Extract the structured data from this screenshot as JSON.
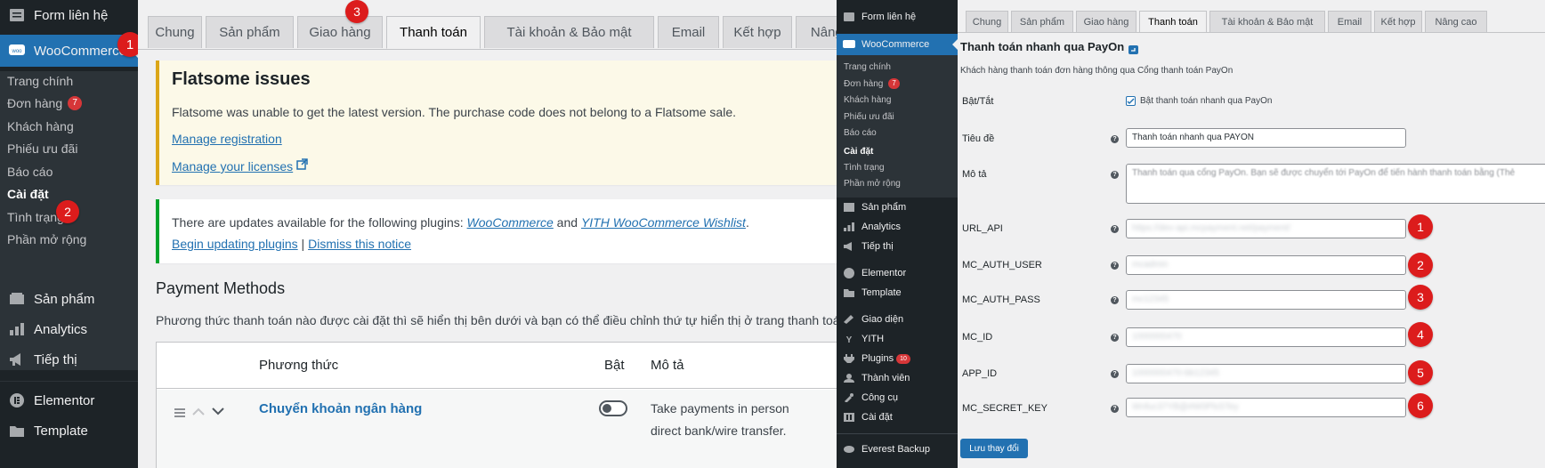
{
  "left": {
    "sidebar": {
      "items_top": [
        {
          "icon": "form-icon",
          "label": "Form liên hệ"
        },
        {
          "icon": "woo-icon",
          "label": "WooCommerce"
        }
      ],
      "woo_sub": [
        {
          "label": "Trang chính"
        },
        {
          "label": "Đơn hàng",
          "count": "7"
        },
        {
          "label": "Khách hàng"
        },
        {
          "label": "Phiếu ưu đãi"
        },
        {
          "label": "Báo cáo"
        },
        {
          "label": "Cài đặt"
        },
        {
          "label": "Tình trạng"
        },
        {
          "label": "Phần mở rộng"
        }
      ],
      "items_bottom": [
        {
          "icon": "products-icon",
          "label": "Sản phẩm"
        },
        {
          "icon": "analytics-icon",
          "label": "Analytics"
        },
        {
          "icon": "marketing-icon",
          "label": "Tiếp thị"
        },
        {
          "icon": "elementor-icon",
          "label": "Elementor"
        },
        {
          "icon": "template-icon",
          "label": "Template"
        }
      ]
    },
    "tabs": [
      "Chung",
      "Sản phẩm",
      "Giao hàng",
      "Thanh toán",
      "Tài khoản & Bảo mật",
      "Email",
      "Kết hợp",
      "Nâng cao"
    ],
    "notice_flatsome": {
      "title": "Flatsome issues",
      "text": "Flatsome was unable to get the latest version. The purchase code does not belong to a Flatsome sale.",
      "link1": "Manage registration",
      "link2": "Manage your licenses"
    },
    "notice_updates": {
      "text_before": "There are updates available for the following plugins: ",
      "plugin1": "WooCommerce",
      "and": " and ",
      "plugin2": "YITH WooCommerce Wishlist",
      "dot": ".",
      "link1": "Begin updating plugins",
      "sep": " | ",
      "link2": "Dismiss this notice"
    },
    "payment": {
      "heading": "Payment Methods",
      "desc": "Phương thức thanh toán nào được cài đặt thì sẽ hiển thị bên dưới và bạn có thể điều chỉnh thứ tự hiển thị ở trang thanh toán khi mu",
      "col_method": "Phương thức",
      "col_enabled": "Bật",
      "col_desc": "Mô tả",
      "row_name": "Chuyển khoản ngân hàng",
      "row_desc1": "Take payments in person",
      "row_desc2": "direct bank/wire transfer."
    },
    "markers": [
      "1",
      "2",
      "3"
    ]
  },
  "right": {
    "sidebar": {
      "items_top": [
        {
          "label": "Form liên hệ"
        },
        {
          "label": "WooCommerce"
        }
      ],
      "woo_sub": [
        {
          "label": "Trang chính"
        },
        {
          "label": "Đơn hàng",
          "count": "7"
        },
        {
          "label": "Khách hàng"
        },
        {
          "label": "Phiếu ưu đãi"
        },
        {
          "label": "Báo cáo"
        },
        {
          "label": "Cài đặt"
        },
        {
          "label": "Tình trạng"
        },
        {
          "label": "Phần mở rộng"
        }
      ],
      "items_bottom": [
        {
          "icon": "products-icon",
          "label": "Sản phẩm"
        },
        {
          "icon": "analytics-icon",
          "label": "Analytics"
        },
        {
          "icon": "marketing-icon",
          "label": "Tiếp thị"
        },
        {
          "icon": "elementor-icon",
          "label": "Elementor"
        },
        {
          "icon": "template-icon",
          "label": "Template"
        },
        {
          "icon": "appearance-icon",
          "label": "Giao diện"
        },
        {
          "icon": "yith-icon",
          "label": "YITH"
        },
        {
          "icon": "plugins-icon",
          "label": "Plugins",
          "count": "10"
        },
        {
          "icon": "users-icon",
          "label": "Thành viên"
        },
        {
          "icon": "tools-icon",
          "label": "Công cụ"
        },
        {
          "icon": "settings-icon",
          "label": "Cài đặt"
        },
        {
          "icon": "backup-icon",
          "label": "Everest Backup"
        }
      ]
    },
    "tabs": [
      "Chung",
      "Sản phẩm",
      "Giao hàng",
      "Thanh toán",
      "Tài khoản & Bảo mật",
      "Email",
      "Kết hợp",
      "Nâng cao"
    ],
    "section_title": "Thanh toán nhanh qua PayOn",
    "section_desc": "Khách hàng thanh toán đơn hàng thông qua Cổng thanh toán PayOn",
    "fields": {
      "enable_label": "Bật/Tắt",
      "enable_text": "Bật thanh toán nhanh qua PayOn",
      "title_label": "Tiêu đề",
      "title_value": "Thanh toán nhanh qua PAYON",
      "desc_label": "Mô tả",
      "desc_value": "Thanh toán qua cổng PayOn. Bạn sẽ được chuyển tới PayOn để tiến hành thanh toán bằng (Thẻ",
      "url_label": "URL_API",
      "url_value": "https://dev-api.mcpayment.net/payment/",
      "user_label": "MC_AUTH_USER",
      "user_value": "mcadmin",
      "pass_label": "MC_AUTH_PASS",
      "pass_value": "mc12345",
      "id_label": "MC_ID",
      "id_value": "1000000470",
      "app_label": "APP_ID",
      "app_value": "1000000470-bb12345",
      "secret_label": "MC_SECRET_KEY",
      "secret_value": "Wnfuc37YB@#W0PlsSTey"
    },
    "save_button": "Lưu thay đổi",
    "markers": [
      "1",
      "2",
      "3",
      "4",
      "5",
      "6"
    ]
  }
}
